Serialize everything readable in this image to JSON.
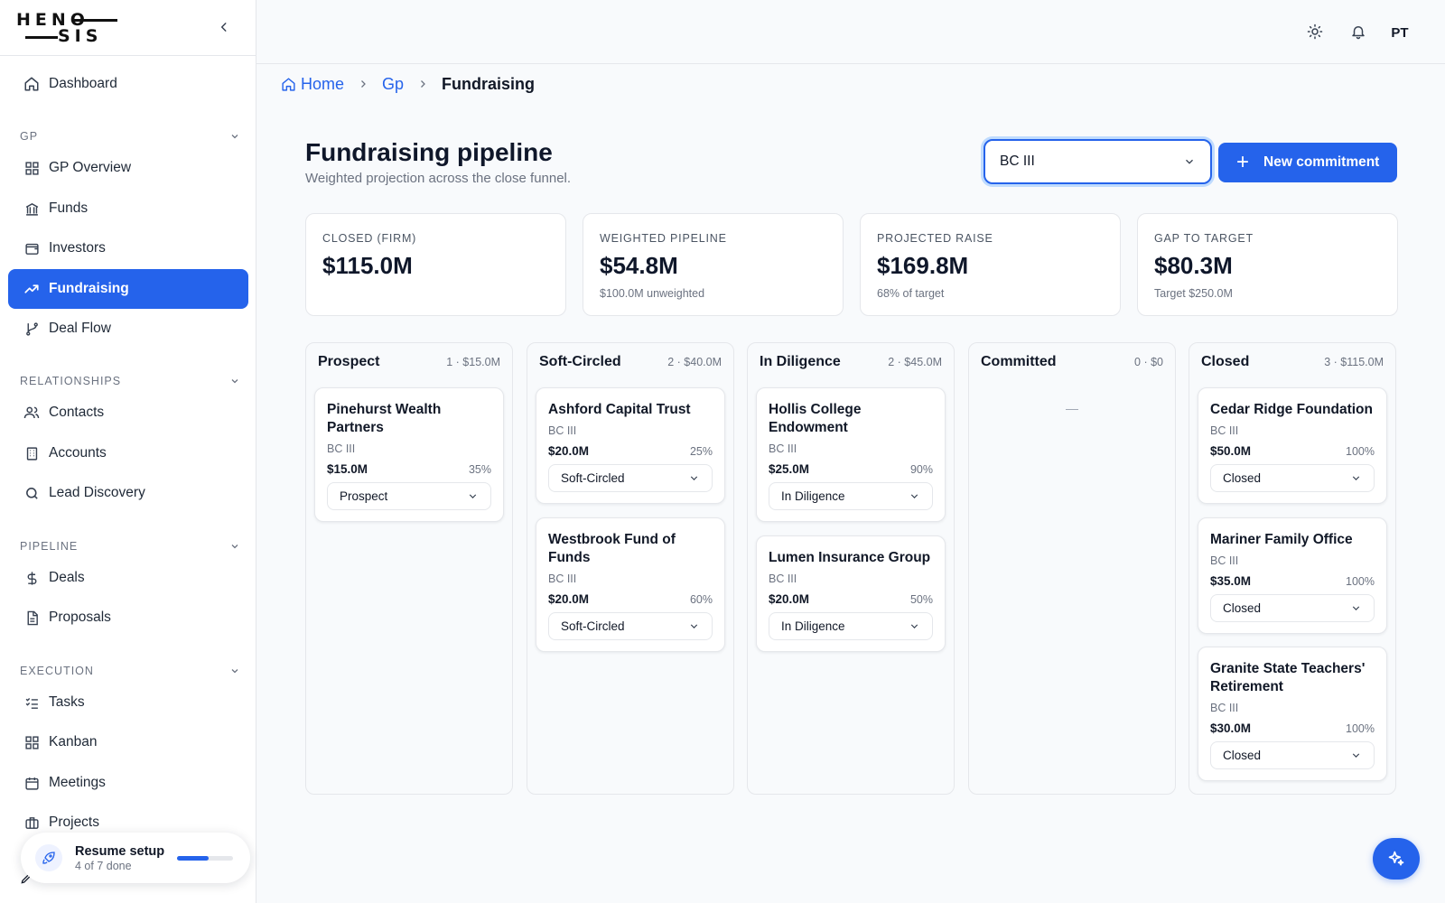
{
  "brand": {
    "logo_line1": "HENO",
    "logo_line2": "SIS"
  },
  "sidebar": {
    "dashboard": {
      "label": "Dashboard",
      "icon": "home-icon"
    },
    "sections": [
      {
        "title": "GP",
        "items": [
          {
            "label": "GP Overview",
            "icon": "grid-icon"
          },
          {
            "label": "Funds",
            "icon": "bank-icon"
          },
          {
            "label": "Investors",
            "icon": "wallet-icon"
          },
          {
            "label": "Fundraising",
            "icon": "trend-up-icon",
            "active": true
          },
          {
            "label": "Deal Flow",
            "icon": "git-branch-icon"
          }
        ]
      },
      {
        "title": "RELATIONSHIPS",
        "items": [
          {
            "label": "Contacts",
            "icon": "users-icon"
          },
          {
            "label": "Accounts",
            "icon": "building-icon"
          },
          {
            "label": "Lead Discovery",
            "icon": "search-icon"
          }
        ]
      },
      {
        "title": "PIPELINE",
        "items": [
          {
            "label": "Deals",
            "icon": "dollar-icon"
          },
          {
            "label": "Proposals",
            "icon": "document-icon"
          }
        ]
      },
      {
        "title": "EXECUTION",
        "items": [
          {
            "label": "Tasks",
            "icon": "checklist-icon"
          },
          {
            "label": "Kanban",
            "icon": "grid-icon"
          },
          {
            "label": "Meetings",
            "icon": "calendar-icon"
          },
          {
            "label": "Projects",
            "icon": "briefcase-icon"
          }
        ]
      }
    ],
    "setup": {
      "title": "Resume setup",
      "subtitle": "4 of 7 done",
      "progress": 0.57
    }
  },
  "topbar": {
    "avatar_initials": "PT"
  },
  "breadcrumb": {
    "home": "Home",
    "gp": "Gp",
    "current": "Fundraising"
  },
  "page": {
    "title": "Fundraising pipeline",
    "subtitle": "Weighted projection across the close funnel.",
    "fund_select": "BC III",
    "new_button": "New commitment"
  },
  "kpis": [
    {
      "label": "CLOSED (FIRM)",
      "value": "$115.0M",
      "sub": ""
    },
    {
      "label": "WEIGHTED PIPELINE",
      "value": "$54.8M",
      "sub": "$100.0M unweighted"
    },
    {
      "label": "PROJECTED RAISE",
      "value": "$169.8M",
      "sub": "68% of target"
    },
    {
      "label": "GAP TO TARGET",
      "value": "$80.3M",
      "sub": "Target $250.0M"
    }
  ],
  "columns": [
    {
      "name": "Prospect",
      "meta": "1 · $15.0M",
      "cards": [
        {
          "name": "Pinehurst Wealth Partners",
          "fund": "BC III",
          "amount": "$15.0M",
          "pct": "35%",
          "stage": "Prospect"
        }
      ]
    },
    {
      "name": "Soft-Circled",
      "meta": "2 · $40.0M",
      "cards": [
        {
          "name": "Ashford Capital Trust",
          "fund": "BC III",
          "amount": "$20.0M",
          "pct": "25%",
          "stage": "Soft-Circled"
        },
        {
          "name": "Westbrook Fund of Funds",
          "fund": "BC III",
          "amount": "$20.0M",
          "pct": "60%",
          "stage": "Soft-Circled"
        }
      ]
    },
    {
      "name": "In Diligence",
      "meta": "2 · $45.0M",
      "cards": [
        {
          "name": "Hollis College Endowment",
          "fund": "BC III",
          "amount": "$25.0M",
          "pct": "90%",
          "stage": "In Diligence"
        },
        {
          "name": "Lumen Insurance Group",
          "fund": "BC III",
          "amount": "$20.0M",
          "pct": "50%",
          "stage": "In Diligence"
        }
      ]
    },
    {
      "name": "Committed",
      "meta": "0 · $0",
      "empty": "—",
      "cards": []
    },
    {
      "name": "Closed",
      "meta": "3 · $115.0M",
      "cards": [
        {
          "name": "Cedar Ridge Foundation",
          "fund": "BC III",
          "amount": "$50.0M",
          "pct": "100%",
          "stage": "Closed"
        },
        {
          "name": "Mariner Family Office",
          "fund": "BC III",
          "amount": "$35.0M",
          "pct": "100%",
          "stage": "Closed"
        },
        {
          "name": "Granite State Teachers' Retirement",
          "fund": "BC III",
          "amount": "$30.0M",
          "pct": "100%",
          "stage": "Closed"
        }
      ]
    }
  ],
  "colors": {
    "accent": "#2563eb",
    "border": "#e5e7eb",
    "muted": "#6b7280"
  }
}
